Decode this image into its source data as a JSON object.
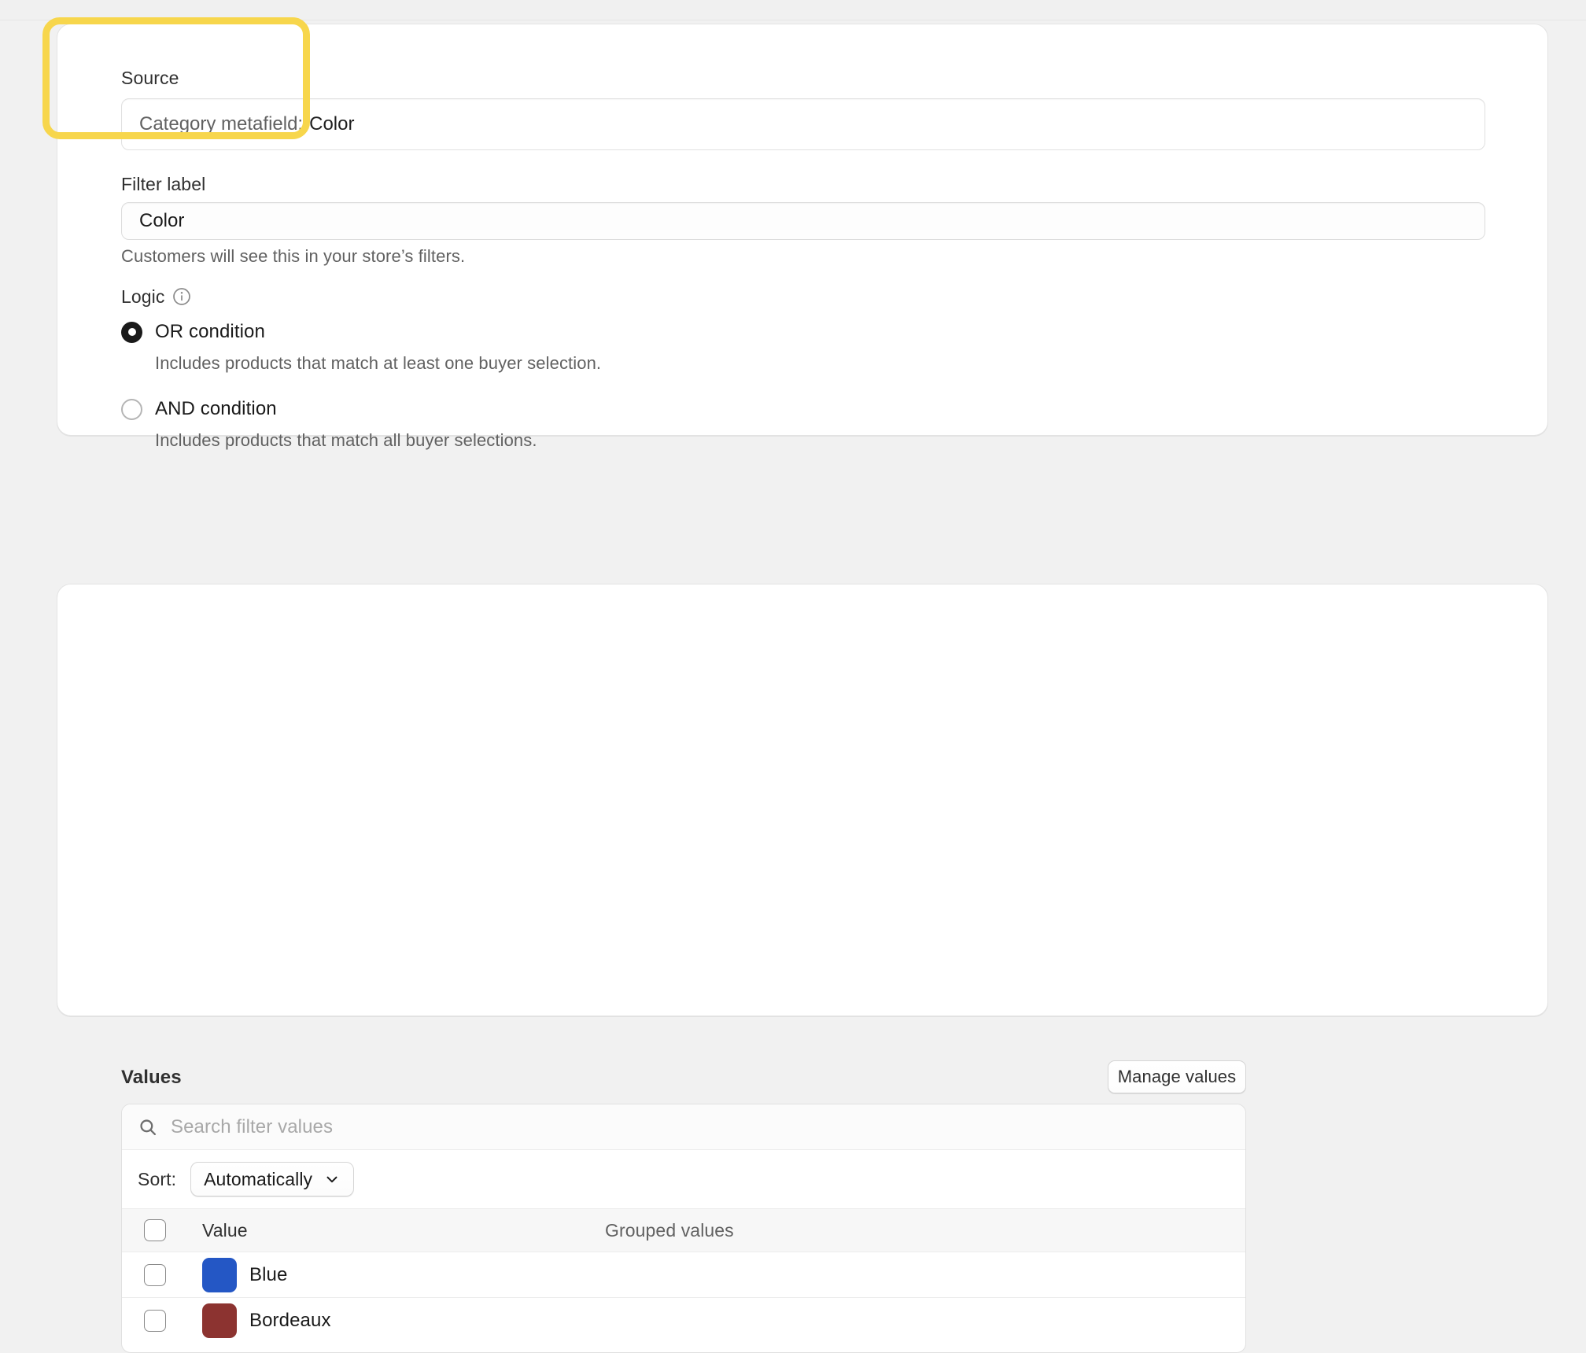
{
  "page": {
    "background_color": "#f1f1f1",
    "highlight_color": "#f7d64c"
  },
  "source_card": {
    "source_label": "Source",
    "source_field": {
      "prefix": "Category metafield:",
      "value": "Color"
    },
    "filter_label_label": "Filter label",
    "filter_label_value": "Color",
    "filter_label_help": "Customers will see this in your store’s filters.",
    "logic_label": "Logic",
    "logic_info_icon": "info-icon",
    "logic_options": [
      {
        "label": "OR condition",
        "description": "Includes products that match at least one buyer selection.",
        "selected": true
      },
      {
        "label": "AND condition",
        "description": "Includes products that match all buyer selections.",
        "selected": false
      }
    ]
  },
  "values_card": {
    "title": "Values",
    "manage_values_label": "Manage values",
    "search": {
      "icon": "search-icon",
      "placeholder": "Search filter values",
      "value": ""
    },
    "sort": {
      "caption": "Sort:",
      "selected": "Automatically",
      "chevron_icon": "chevron-down-icon"
    },
    "table": {
      "columns": {
        "value": "Value",
        "grouped": "Grouped values"
      },
      "rows": [
        {
          "checked": false,
          "swatch_color": "#2457c5",
          "name": "Blue",
          "grouped": ""
        },
        {
          "checked": false,
          "swatch_color": "#8c3330",
          "name": "Bordeaux",
          "grouped": ""
        }
      ]
    }
  }
}
